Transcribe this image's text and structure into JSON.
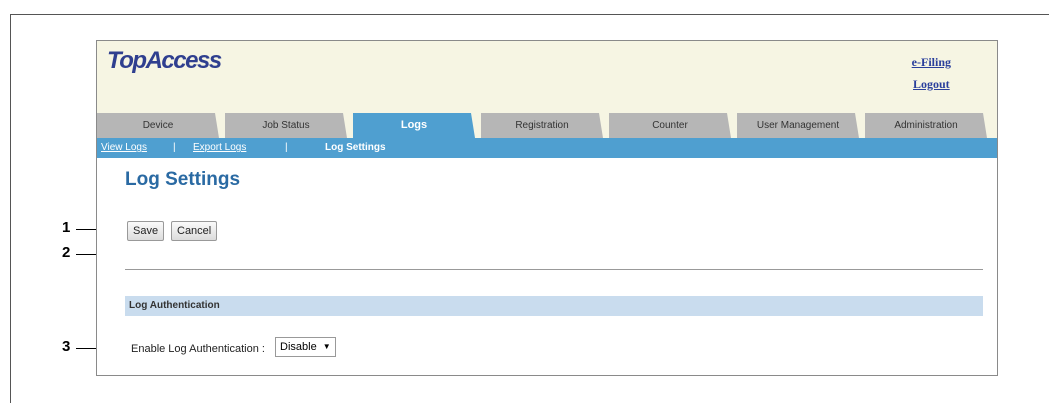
{
  "brand": {
    "logo": "TopAccess"
  },
  "header_links": [
    "e-Filing",
    "Logout"
  ],
  "tabs": [
    "Device",
    "Job Status",
    "Logs",
    "Registration",
    "Counter",
    "User Management",
    "Administration"
  ],
  "active_tab": "Logs",
  "subnav": {
    "view_logs": "View Logs",
    "sep": "|",
    "export_logs": "Export Logs",
    "log_settings": "Log Settings"
  },
  "page_title": "Log Settings",
  "buttons": {
    "save": "Save",
    "cancel": "Cancel"
  },
  "section_header": "Log Authentication",
  "field": {
    "label": "Enable Log Authentication :",
    "value": "Disable"
  },
  "callouts": [
    "1",
    "2",
    "3"
  ]
}
